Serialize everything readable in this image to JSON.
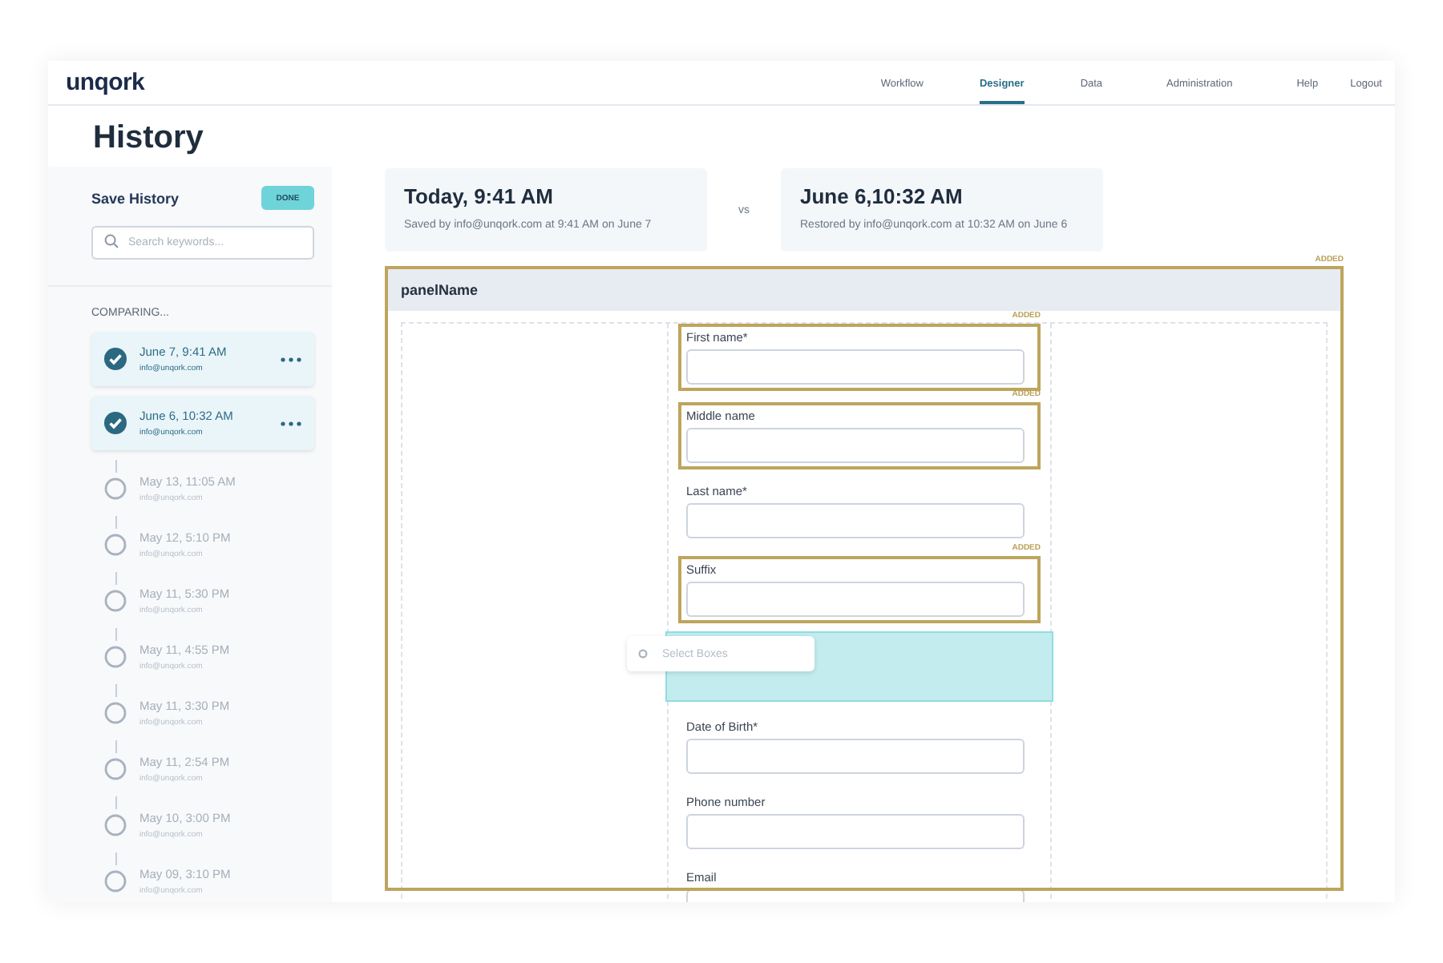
{
  "logo": "unqork",
  "nav": [
    {
      "label": "Workflow",
      "selected": false
    },
    {
      "label": "Designer",
      "selected": true
    },
    {
      "label": "Data",
      "selected": false
    },
    {
      "label": "Administration",
      "selected": false
    },
    {
      "label": "Help",
      "selected": false
    },
    {
      "label": "Logout",
      "selected": false
    }
  ],
  "page_title": "History",
  "sidebar": {
    "title": "Save History",
    "done_button": "DONE",
    "search": {
      "placeholder": "Search keywords..."
    },
    "section_label": "COMPARING...",
    "items": [
      {
        "time": "June 7, 9:41 AM",
        "user": "info@unqork.com",
        "selected": true
      },
      {
        "time": "June 6, 10:32 AM",
        "user": "info@unqork.com",
        "selected": true
      },
      {
        "time": "May 13, 11:05 AM",
        "user": "info@unqork.com",
        "selected": false
      },
      {
        "time": "May 12, 5:10 PM",
        "user": "info@unqork.com",
        "selected": false
      },
      {
        "time": "May 11, 5:30 PM",
        "user": "info@unqork.com",
        "selected": false
      },
      {
        "time": "May 11, 4:55 PM",
        "user": "info@unqork.com",
        "selected": false
      },
      {
        "time": "May 11, 3:30 PM",
        "user": "info@unqork.com",
        "selected": false
      },
      {
        "time": "May 11, 2:54 PM",
        "user": "info@unqork.com",
        "selected": false
      },
      {
        "time": "May 10, 3:00 PM",
        "user": "info@unqork.com",
        "selected": false
      },
      {
        "time": "May 09, 3:10 PM",
        "user": "info@unqork.com",
        "selected": false
      }
    ]
  },
  "compare": {
    "left": {
      "title": "Today, 9:41 AM",
      "subtitle": "Saved by info@unqork.com at 9:41 AM on June 7"
    },
    "separator": "vs",
    "right": {
      "title": "June 6,10:32 AM",
      "subtitle": "Restored by info@unqork.com at 10:32 AM on June 6"
    }
  },
  "panel": {
    "badge": "ADDED",
    "added": true,
    "title": "panelName",
    "components": [
      {
        "kind": "field",
        "label": "First name*",
        "badge": "ADDED",
        "added": true
      },
      {
        "kind": "field",
        "label": "Middle name",
        "badge": "ADDED",
        "added": true
      },
      {
        "kind": "field",
        "label": "Last name*",
        "added": false
      },
      {
        "kind": "field",
        "label": "Suffix",
        "badge": "ADDED",
        "added": true
      },
      {
        "kind": "dropzone",
        "drag_label": "Select Boxes"
      },
      {
        "kind": "field",
        "label": "Date of Birth*",
        "added": false
      },
      {
        "kind": "field",
        "label": "Phone number",
        "added": false
      },
      {
        "kind": "field",
        "label": "Email",
        "added": false
      }
    ]
  }
}
